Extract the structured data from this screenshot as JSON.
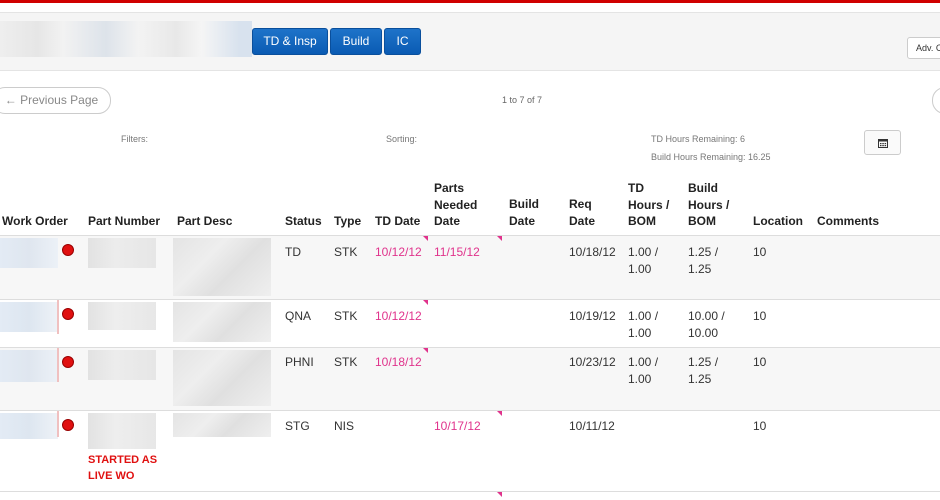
{
  "nav": {
    "buttons": [
      "TD & Insp",
      "Build",
      "IC"
    ],
    "adv_label": "Adv. C"
  },
  "pager": {
    "prev_label": "← Previous Page",
    "count": "1 to 7 of 7"
  },
  "info": {
    "filters": "Filters:",
    "sorting": "Sorting:",
    "td_remaining": "TD Hours Remaining: 6",
    "build_remaining": "Build Hours Remaining: 16.25"
  },
  "table": {
    "headers": {
      "work_order": "Work Order",
      "part_number": "Part Number",
      "part_desc": "Part Desc",
      "status": "Status",
      "type": "Type",
      "td_date": "TD Date",
      "parts_needed": [
        "Parts",
        "Needed",
        "Date"
      ],
      "build_date": [
        "Build",
        "Date"
      ],
      "req_date": [
        "Req",
        "Date"
      ],
      "td_hours": [
        "TD",
        "Hours /",
        "BOM"
      ],
      "build_hours": [
        "Build",
        "Hours /",
        "BOM"
      ],
      "location": "Location",
      "comments": "Comments"
    },
    "rows": [
      {
        "status": "TD",
        "type": "STK",
        "td_date": "10/12/12",
        "parts_needed": "11/15/12",
        "build_date": "",
        "req_date": "10/18/12",
        "td_hours": [
          "1.00 /",
          "1.00"
        ],
        "build_hours": [
          "1.25 /",
          "1.25"
        ],
        "location": "10",
        "note": ""
      },
      {
        "status": "QNA",
        "type": "STK",
        "td_date": "10/12/12",
        "parts_needed": "",
        "build_date": "",
        "req_date": "10/19/12",
        "td_hours": [
          "1.00 /",
          "1.00"
        ],
        "build_hours": [
          "10.00 /",
          "10.00"
        ],
        "location": "10",
        "note": ""
      },
      {
        "status": "PHNI",
        "type": "STK",
        "td_date": "10/18/12",
        "parts_needed": "",
        "build_date": "",
        "req_date": "10/23/12",
        "td_hours": [
          "1.00 /",
          "1.00"
        ],
        "build_hours": [
          "1.25 /",
          "1.25"
        ],
        "location": "10",
        "note": ""
      },
      {
        "status": "STG",
        "type": "NIS",
        "td_date": "",
        "parts_needed": "10/17/12",
        "build_date": "",
        "req_date": "10/11/12",
        "td_hours": [
          "",
          ""
        ],
        "build_hours": [
          "",
          ""
        ],
        "location": "10",
        "note": "STARTED AS LIVE WO"
      }
    ]
  },
  "colors": {
    "accent": "#d00000",
    "button": "#0a5bb3",
    "date": "#e0338c",
    "status_dot": "#e01010"
  }
}
